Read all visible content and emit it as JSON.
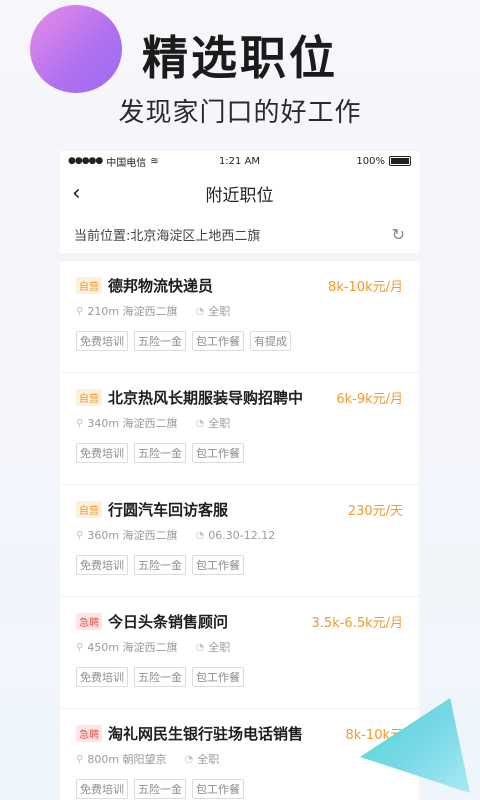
{
  "hero": {
    "title": "精选职位",
    "subtitle": "发现家门口的好工作"
  },
  "status_bar": {
    "carrier": "中国电信",
    "time": "1:21 AM",
    "battery": "100%"
  },
  "nav": {
    "title": "附近职位"
  },
  "location": {
    "text": "当前位置:北京海淀区上地西二旗"
  },
  "jobs": [
    {
      "badge": "自营",
      "title": "德邦物流快递员",
      "salary": "8k-10k元/月",
      "distance": "210m 海淀西二旗",
      "type": "全职",
      "tags": [
        "免费培训",
        "五险一金",
        "包工作餐",
        "有提成"
      ]
    },
    {
      "badge": "自营",
      "title": "北京热风长期服装导购招聘中",
      "salary": "6k-9k元/月",
      "distance": "340m 海淀西二旗",
      "type": "全职",
      "tags": [
        "免费培训",
        "五险一金",
        "包工作餐"
      ]
    },
    {
      "badge": "自营",
      "title": "行圆汽车回访客服",
      "salary": "230元/天",
      "distance": "360m 海淀西二旗",
      "type": "06.30-12.12",
      "tags": [
        "免费培训",
        "五险一金",
        "包工作餐"
      ]
    },
    {
      "badge": "急聘",
      "title": "今日头条销售顾问",
      "salary": "3.5k-6.5k元/月",
      "distance": "450m 海淀西二旗",
      "type": "全职",
      "tags": [
        "免费培训",
        "五险一金",
        "包工作餐"
      ]
    },
    {
      "badge": "急聘",
      "title": "淘礼网民生银行驻场电话销售",
      "salary": "8k-10k元",
      "distance": "800m 朝阳望京",
      "type": "全职",
      "tags": [
        "免费培训",
        "五险一金",
        "包工作餐"
      ]
    }
  ],
  "colors": {
    "accent": "#f39a2a",
    "urgent": "#f0544d"
  }
}
